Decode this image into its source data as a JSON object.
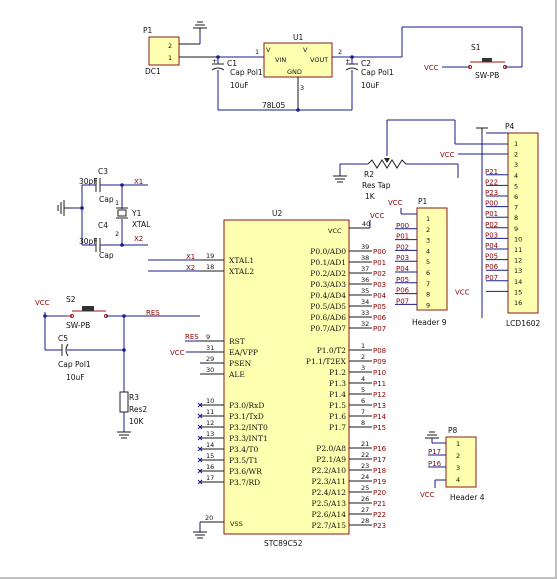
{
  "components": {
    "p1_power": {
      "designator": "P1",
      "pins": [
        "2",
        "1"
      ],
      "comment": "DC1"
    },
    "u1": {
      "designator": "U1",
      "pin_in": "VIN",
      "pin_out": "VOUT",
      "pin_gnd": "GND",
      "pin_nums": [
        "1",
        "2",
        "3"
      ],
      "comment": "78L05"
    },
    "c1": {
      "designator": "C1",
      "comment": "Cap Pol1",
      "value": "10uF"
    },
    "c2": {
      "designator": "C2",
      "comment": "Cap Pol1",
      "value": "10uF"
    },
    "s1": {
      "designator": "S1",
      "comment": "SW-PB",
      "net": "VCC"
    },
    "r2": {
      "designator": "R2",
      "comment": "Res Tap",
      "value": "1K",
      "net": "VCC"
    },
    "p4": {
      "designator": "P4",
      "comment": "LCD1602",
      "pins": [
        "1",
        "2",
        "3",
        "4",
        "5",
        "6",
        "7",
        "8",
        "9",
        "10",
        "11",
        "12",
        "13",
        "14",
        "15",
        "16"
      ],
      "nets": [
        "",
        "",
        "",
        "P21",
        "P22",
        "P23",
        "P00",
        "P01",
        "P02",
        "P03",
        "P04",
        "P05",
        "P06",
        "P07",
        "VCC",
        ""
      ]
    },
    "c3": {
      "designator": "C3",
      "comment": "Cap",
      "value": "30pF"
    },
    "c4": {
      "designator": "C4",
      "comment": "Cap",
      "value": "30pF"
    },
    "y1": {
      "designator": "Y1",
      "comment": "XTAL",
      "pins": [
        "1",
        "2"
      ]
    },
    "p1_header": {
      "designator": "P1",
      "comment": "Header 9",
      "net": "VCC",
      "pins": [
        "1",
        "2",
        "3",
        "4",
        "5",
        "6",
        "7",
        "8",
        "9"
      ],
      "nets": [
        "P00",
        "P01",
        "P02",
        "P03",
        "P04",
        "P05",
        "P06",
        "P07"
      ]
    },
    "s2": {
      "designator": "S2",
      "comment": "SW-PB",
      "net": "VCC",
      "reset_net": "RES"
    },
    "c5": {
      "designator": "C5",
      "comment": "Cap Pol1",
      "value": "10uF"
    },
    "r3": {
      "designator": "R3",
      "comment": "Res2",
      "value": "10K"
    },
    "p8": {
      "designator": "P8",
      "comment": "Header 4",
      "pins": [
        "1",
        "2",
        "3",
        "4"
      ],
      "nets": [
        "P17",
        "P16"
      ],
      "vcc": "VCC"
    },
    "u2": {
      "designator": "U2",
      "comment": "STC89C52",
      "vcc_pin": "40",
      "vcc_label": "VCC",
      "vss_pin": "20",
      "vss_label": "VSS",
      "left_pins": [
        {
          "num": "19",
          "name": "XTAL1",
          "net": "X1"
        },
        {
          "num": "18",
          "name": "XTAL2",
          "net": "X2"
        },
        {
          "num": "9",
          "name": "RST",
          "net": "RES"
        },
        {
          "num": "31",
          "name": "EA/VPP",
          "net": "VCC"
        },
        {
          "num": "29",
          "name": "PSEN",
          "net": ""
        },
        {
          "num": "30",
          "name": "ALE",
          "net": ""
        },
        {
          "num": "10",
          "name": "P3.0/RxD",
          "net": ""
        },
        {
          "num": "11",
          "name": "P3.1/TxD",
          "net": ""
        },
        {
          "num": "12",
          "name": "P3.2/INT0",
          "net": ""
        },
        {
          "num": "13",
          "name": "P3.3/INT1",
          "net": ""
        },
        {
          "num": "14",
          "name": "P3.4/T0",
          "net": ""
        },
        {
          "num": "15",
          "name": "P3.5/T1",
          "net": ""
        },
        {
          "num": "16",
          "name": "P3.6/WR",
          "net": ""
        },
        {
          "num": "17",
          "name": "P3.7/RD",
          "net": ""
        }
      ],
      "right_pins": [
        {
          "num": "39",
          "name": "P0.0/AD0",
          "net": "P00"
        },
        {
          "num": "38",
          "name": "P0.1/AD1",
          "net": "P01"
        },
        {
          "num": "37",
          "name": "P0.2/AD2",
          "net": "P02"
        },
        {
          "num": "36",
          "name": "P0.3/AD3",
          "net": "P03"
        },
        {
          "num": "35",
          "name": "P0.4/AD4",
          "net": "P04"
        },
        {
          "num": "34",
          "name": "P0.5/AD5",
          "net": "P05"
        },
        {
          "num": "33",
          "name": "P0.6/AD6",
          "net": "P06"
        },
        {
          "num": "32",
          "name": "P0.7/AD7",
          "net": "P07"
        },
        {
          "num": "1",
          "name": "P1.0/T2",
          "net": "P08"
        },
        {
          "num": "2",
          "name": "P1.1/T2EX",
          "net": "P09"
        },
        {
          "num": "3",
          "name": "P1.2",
          "net": "P10"
        },
        {
          "num": "4",
          "name": "P1.3",
          "net": "P11"
        },
        {
          "num": "5",
          "name": "P1.4",
          "net": "P12"
        },
        {
          "num": "6",
          "name": "P1.5",
          "net": "P13"
        },
        {
          "num": "7",
          "name": "P1.6",
          "net": "P14"
        },
        {
          "num": "8",
          "name": "P1.7",
          "net": "P15"
        },
        {
          "num": "21",
          "name": "P2.0/A8",
          "net": "P16"
        },
        {
          "num": "22",
          "name": "P2.1/A9",
          "net": "P17"
        },
        {
          "num": "23",
          "name": "P2.2/A10",
          "net": "P18"
        },
        {
          "num": "24",
          "name": "P2.3/A11",
          "net": "P19"
        },
        {
          "num": "25",
          "name": "P2.4/A12",
          "net": "P20"
        },
        {
          "num": "26",
          "name": "P2.5/A13",
          "net": "P21"
        },
        {
          "num": "27",
          "name": "P2.6/A14",
          "net": "P22"
        },
        {
          "num": "28",
          "name": "P2.7/A15",
          "net": "P23"
        }
      ]
    }
  },
  "colors": {
    "wire": "#1a1a8c",
    "body_fill": "#ffffb0",
    "body_stroke": "#8b1a1a",
    "net_label": "#8b0000"
  }
}
